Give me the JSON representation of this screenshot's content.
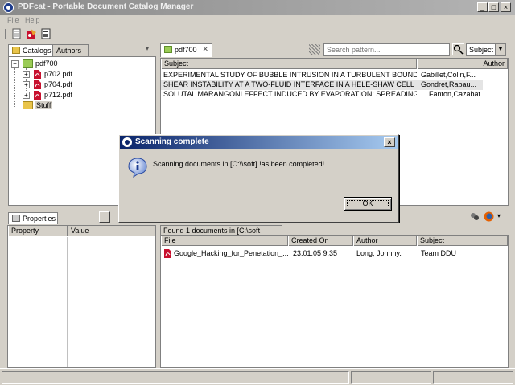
{
  "window": {
    "title": "PDFcat - Portable Document Catalog Manager"
  },
  "menu": {
    "file": "File",
    "help": "Help"
  },
  "left_panel": {
    "tabs": [
      {
        "label": "Catalogs"
      },
      {
        "label": "Authors"
      }
    ],
    "tree": {
      "root": "pdf700",
      "children": [
        "p702.pdf",
        "p704.pdf",
        "p712.pdf"
      ],
      "stuff": "Stuff"
    }
  },
  "main_panel": {
    "tab_label": "pdf700",
    "search": {
      "placeholder": "Search pattern..."
    },
    "search_field": {
      "selected": "Subject"
    },
    "columns": {
      "subject": "Subject",
      "author": "Author"
    },
    "rows": [
      {
        "subject": "EXPERIMENTAL STUDY OF BUBBLE INTRUSION IN A TURBULENT BOUNDARY LA...",
        "author": "Gabillet,Colin,F..."
      },
      {
        "subject": "SHEAR INSTABILITY AT A TWO-FLUID INTERFACE IN A HELE-SHAW CELL",
        "author": "Gondret,Rabau..."
      },
      {
        "subject": "SOLUTAL MARANGONI EFFECT INDUCED BY EVAPORATION: SPREADING AND I...",
        "author": "Fanton,Cazabat"
      }
    ]
  },
  "properties_panel": {
    "tab_label": "Properties",
    "columns": {
      "property": "Property",
      "value": "Value"
    }
  },
  "results_panel": {
    "status": "Found 1 documents in [C:\\soft",
    "columns": {
      "file": "File",
      "created_on": "Created On",
      "author": "Author",
      "subject": "Subject"
    },
    "rows": [
      {
        "file": "Google_Hacking_for_Penetation_...",
        "created_on": "23.01.05 9:35",
        "author": "Long, Johnny.",
        "subject": "Team DDU"
      }
    ]
  },
  "dialog": {
    "title": "Scanning complete",
    "message": "Scanning documents in [C:\\\\soft] !as been completed!",
    "ok_label": "OK"
  },
  "colors": {
    "dialog_title_start": "#0a246a",
    "dialog_title_end": "#a6caf0",
    "pdf_red": "#c8102e"
  }
}
